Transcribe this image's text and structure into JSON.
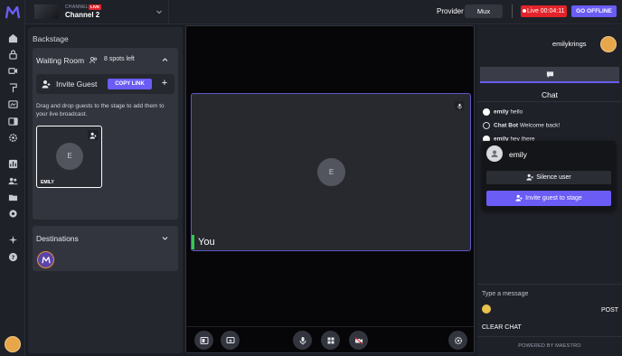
{
  "header": {
    "channel_label": "CHANNEL",
    "live_badge": "LIVE",
    "channel_name": "Channel 2",
    "provider_label": "Provider",
    "provider_value": "Mux",
    "live_timer": "Live 00:04:11",
    "go_offline": "GO OFFLINE"
  },
  "rail": {
    "icons": [
      "home-icon",
      "lock-icon",
      "video-icon",
      "brush-icon",
      "media-icon",
      "panels-icon",
      "gear-icon",
      "analytics-icon",
      "users-icon",
      "folder-icon",
      "settings-icon",
      "sparkle-icon",
      "help-icon"
    ]
  },
  "backstage": {
    "title": "Backstage",
    "waiting_room": {
      "title": "Waiting Room",
      "spots": "8 spots left",
      "invite_label": "Invite Guest",
      "copy_link": "COPY LINK",
      "plus": "+",
      "drag_text": "Drag and drop guests to the stage to add them to your live broadcast.",
      "guest": {
        "initial": "E",
        "name": "EMILY"
      }
    },
    "destinations": {
      "title": "Destinations"
    }
  },
  "stage": {
    "initial": "E",
    "you_label": "You"
  },
  "chat": {
    "username": "emilykrings",
    "title": "Chat",
    "messages": [
      {
        "user": "emily",
        "text": "hello"
      },
      {
        "user": "Chat Bot",
        "text": "Welcome back!"
      },
      {
        "user": "emily",
        "text": "hey there"
      }
    ],
    "popup": {
      "name": "emily",
      "silence": "Silence user",
      "invite": "Invite guest to stage"
    },
    "input_placeholder": "Type a message",
    "post": "POST",
    "clear": "CLEAR CHAT",
    "powered_by": "POWERED BY MAESTRO"
  },
  "colors": {
    "accent": "#6a5cf5",
    "live": "#e2242a",
    "speaking": "#34c759"
  }
}
